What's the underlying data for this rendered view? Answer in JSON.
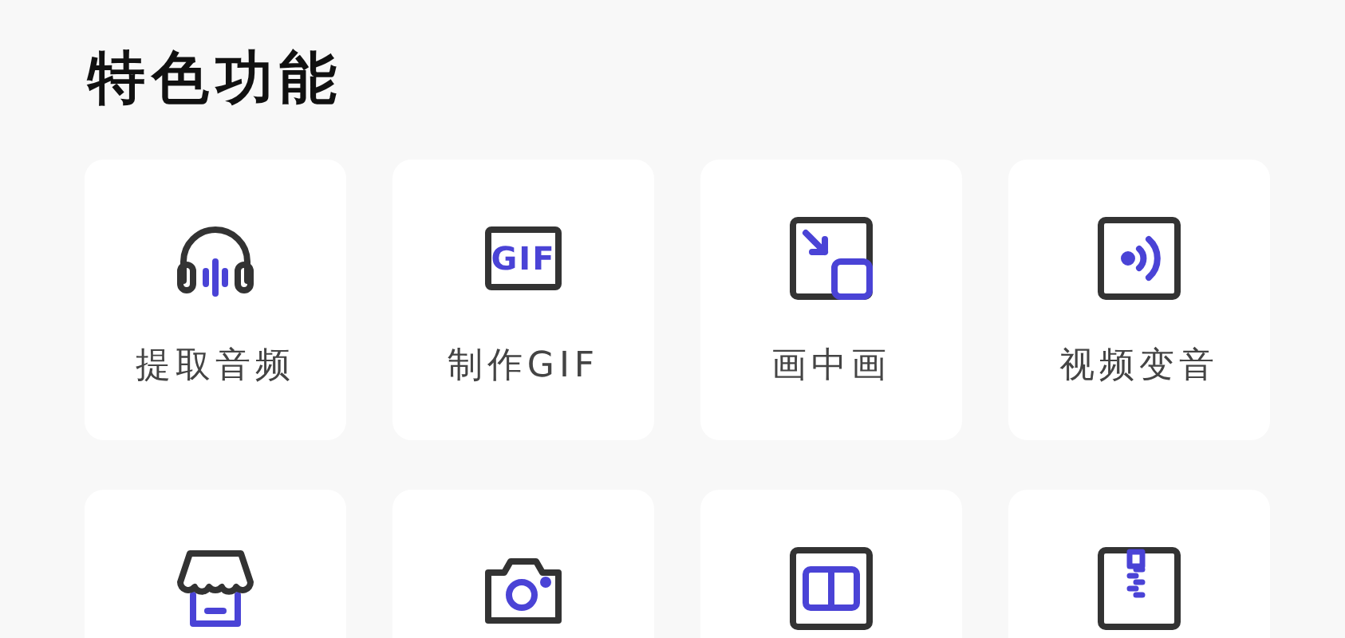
{
  "title": "特色功能",
  "features": [
    {
      "kind": "headphones",
      "label": "提取音频"
    },
    {
      "kind": "gif",
      "label": "制作GIF",
      "icon_text": "GIF"
    },
    {
      "kind": "pip",
      "label": "画中画"
    },
    {
      "kind": "voice",
      "label": "视频变音"
    },
    {
      "kind": "store"
    },
    {
      "kind": "camera"
    },
    {
      "kind": "split"
    },
    {
      "kind": "zip"
    }
  ]
}
